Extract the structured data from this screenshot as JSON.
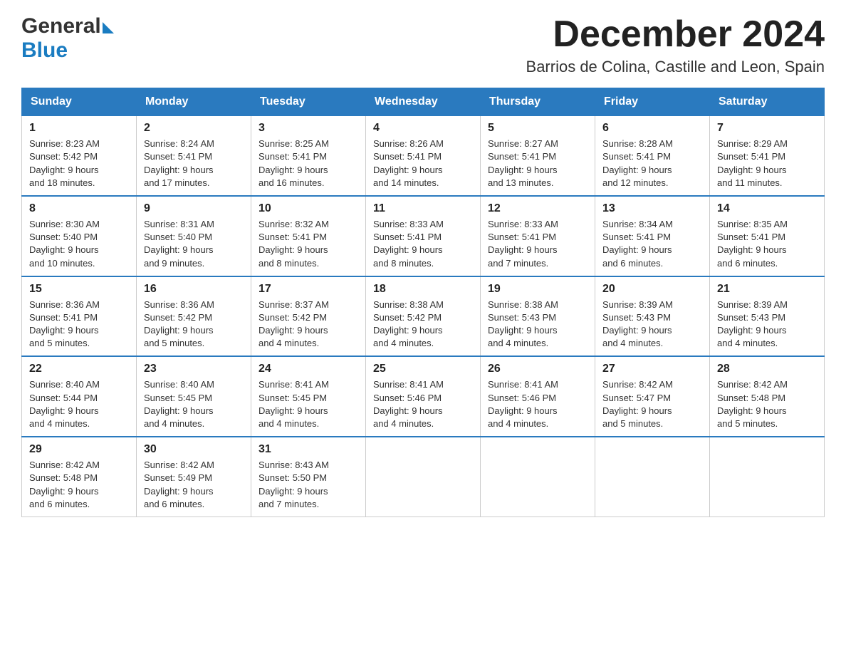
{
  "header": {
    "month_title": "December 2024",
    "location": "Barrios de Colina, Castille and Leon, Spain",
    "logo_general": "General",
    "logo_blue": "Blue"
  },
  "days_of_week": [
    "Sunday",
    "Monday",
    "Tuesday",
    "Wednesday",
    "Thursday",
    "Friday",
    "Saturday"
  ],
  "weeks": [
    [
      {
        "day": "1",
        "sunrise": "8:23 AM",
        "sunset": "5:42 PM",
        "daylight": "9 hours and 18 minutes."
      },
      {
        "day": "2",
        "sunrise": "8:24 AM",
        "sunset": "5:41 PM",
        "daylight": "9 hours and 17 minutes."
      },
      {
        "day": "3",
        "sunrise": "8:25 AM",
        "sunset": "5:41 PM",
        "daylight": "9 hours and 16 minutes."
      },
      {
        "day": "4",
        "sunrise": "8:26 AM",
        "sunset": "5:41 PM",
        "daylight": "9 hours and 14 minutes."
      },
      {
        "day": "5",
        "sunrise": "8:27 AM",
        "sunset": "5:41 PM",
        "daylight": "9 hours and 13 minutes."
      },
      {
        "day": "6",
        "sunrise": "8:28 AM",
        "sunset": "5:41 PM",
        "daylight": "9 hours and 12 minutes."
      },
      {
        "day": "7",
        "sunrise": "8:29 AM",
        "sunset": "5:41 PM",
        "daylight": "9 hours and 11 minutes."
      }
    ],
    [
      {
        "day": "8",
        "sunrise": "8:30 AM",
        "sunset": "5:40 PM",
        "daylight": "9 hours and 10 minutes."
      },
      {
        "day": "9",
        "sunrise": "8:31 AM",
        "sunset": "5:40 PM",
        "daylight": "9 hours and 9 minutes."
      },
      {
        "day": "10",
        "sunrise": "8:32 AM",
        "sunset": "5:41 PM",
        "daylight": "9 hours and 8 minutes."
      },
      {
        "day": "11",
        "sunrise": "8:33 AM",
        "sunset": "5:41 PM",
        "daylight": "9 hours and 8 minutes."
      },
      {
        "day": "12",
        "sunrise": "8:33 AM",
        "sunset": "5:41 PM",
        "daylight": "9 hours and 7 minutes."
      },
      {
        "day": "13",
        "sunrise": "8:34 AM",
        "sunset": "5:41 PM",
        "daylight": "9 hours and 6 minutes."
      },
      {
        "day": "14",
        "sunrise": "8:35 AM",
        "sunset": "5:41 PM",
        "daylight": "9 hours and 6 minutes."
      }
    ],
    [
      {
        "day": "15",
        "sunrise": "8:36 AM",
        "sunset": "5:41 PM",
        "daylight": "9 hours and 5 minutes."
      },
      {
        "day": "16",
        "sunrise": "8:36 AM",
        "sunset": "5:42 PM",
        "daylight": "9 hours and 5 minutes."
      },
      {
        "day": "17",
        "sunrise": "8:37 AM",
        "sunset": "5:42 PM",
        "daylight": "9 hours and 4 minutes."
      },
      {
        "day": "18",
        "sunrise": "8:38 AM",
        "sunset": "5:42 PM",
        "daylight": "9 hours and 4 minutes."
      },
      {
        "day": "19",
        "sunrise": "8:38 AM",
        "sunset": "5:43 PM",
        "daylight": "9 hours and 4 minutes."
      },
      {
        "day": "20",
        "sunrise": "8:39 AM",
        "sunset": "5:43 PM",
        "daylight": "9 hours and 4 minutes."
      },
      {
        "day": "21",
        "sunrise": "8:39 AM",
        "sunset": "5:43 PM",
        "daylight": "9 hours and 4 minutes."
      }
    ],
    [
      {
        "day": "22",
        "sunrise": "8:40 AM",
        "sunset": "5:44 PM",
        "daylight": "9 hours and 4 minutes."
      },
      {
        "day": "23",
        "sunrise": "8:40 AM",
        "sunset": "5:45 PM",
        "daylight": "9 hours and 4 minutes."
      },
      {
        "day": "24",
        "sunrise": "8:41 AM",
        "sunset": "5:45 PM",
        "daylight": "9 hours and 4 minutes."
      },
      {
        "day": "25",
        "sunrise": "8:41 AM",
        "sunset": "5:46 PM",
        "daylight": "9 hours and 4 minutes."
      },
      {
        "day": "26",
        "sunrise": "8:41 AM",
        "sunset": "5:46 PM",
        "daylight": "9 hours and 4 minutes."
      },
      {
        "day": "27",
        "sunrise": "8:42 AM",
        "sunset": "5:47 PM",
        "daylight": "9 hours and 5 minutes."
      },
      {
        "day": "28",
        "sunrise": "8:42 AM",
        "sunset": "5:48 PM",
        "daylight": "9 hours and 5 minutes."
      }
    ],
    [
      {
        "day": "29",
        "sunrise": "8:42 AM",
        "sunset": "5:48 PM",
        "daylight": "9 hours and 6 minutes."
      },
      {
        "day": "30",
        "sunrise": "8:42 AM",
        "sunset": "5:49 PM",
        "daylight": "9 hours and 6 minutes."
      },
      {
        "day": "31",
        "sunrise": "8:43 AM",
        "sunset": "5:50 PM",
        "daylight": "9 hours and 7 minutes."
      },
      null,
      null,
      null,
      null
    ]
  ],
  "labels": {
    "sunrise": "Sunrise:",
    "sunset": "Sunset:",
    "daylight": "Daylight:"
  }
}
